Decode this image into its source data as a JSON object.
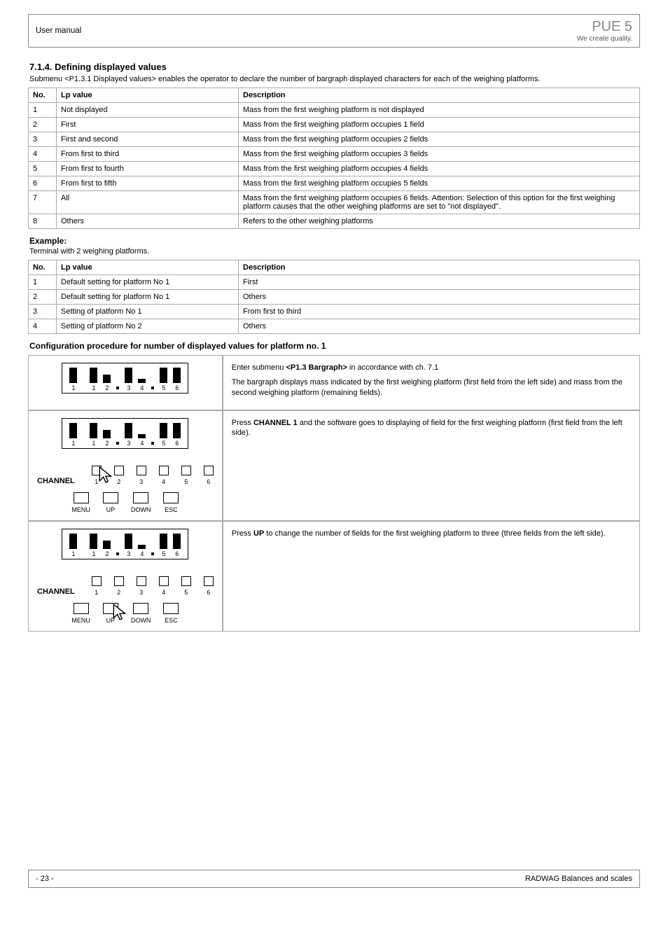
{
  "header": {
    "section": "User manual",
    "model": "PUE 5",
    "tagline": "We create quality."
  },
  "section_title": "7.1.4. Defining displayed values",
  "intro_text": "Submenu <P1.3.1 Displayed values> enables the operator to declare the number of bargraph displayed characters for each of the weighing platforms.",
  "table1": {
    "headers": [
      "No.",
      "Lp value",
      "Description"
    ],
    "rows": [
      [
        "1",
        "Not displayed",
        "Mass from the first weighing platform is not displayed"
      ],
      [
        "2",
        "First",
        "Mass from the first weighing platform occupies 1 field"
      ],
      [
        "3",
        "First and second",
        "Mass from the first weighing platform occupies 2 fields"
      ],
      [
        "4",
        "From first to third",
        "Mass from the first weighing platform occupies 3 fields"
      ],
      [
        "5",
        "From first to fourth",
        "Mass from the first weighing platform occupies 4 fields"
      ],
      [
        "6",
        "From first to fifth",
        "Mass from the first weighing platform occupies 5 fields"
      ],
      [
        "7",
        "All",
        "Mass from the first weighing platform occupies 6 fields. Attention: Selection of this option for the first weighing platform causes that the other weighing platforms are set to \"not displayed\"."
      ],
      [
        "8",
        "Others",
        "Refers to the other weighing platforms"
      ]
    ]
  },
  "example": {
    "title": "Example:",
    "text": "Terminal with 2 weighing platforms.",
    "table_headers": [
      "No.",
      "Lp value",
      "Description"
    ],
    "rows": [
      [
        "1",
        "Default setting for platform No 1",
        "First"
      ],
      [
        "2",
        "Default setting for platform No 1",
        "Others"
      ],
      [
        "3",
        "Setting of platform No 1",
        "From first to third"
      ],
      [
        "4",
        "Setting of platform No 2",
        "Others"
      ]
    ]
  },
  "config_title": "Configuration procedure for number of displayed values for platform no. 1",
  "config_rows": [
    {
      "left_label": "bargraph",
      "desc_lines": [
        "Enter submenu <P1.3 Bargraph> in accordance with ch. 7.1",
        "The bargraph displays mass indicated by the first weighing platform (first field from the left side) and mass from the second weighing platform (remaining fields)."
      ],
      "bars": [
        22,
        22,
        12,
        22,
        6,
        22,
        22
      ]
    },
    {
      "cursor_on": "CHANNEL_1",
      "desc_lines": [
        "Press CHANNEL 1 and the software goes to displaying of field for the first weighing platform (first field from the left side)."
      ],
      "bars": [
        22,
        22,
        12,
        22,
        6,
        22,
        22
      ]
    },
    {
      "cursor_on": "UP",
      "desc_lines": [
        "Press UP to change the number of fields for the first weighing platform to three (three fields from the left side)."
      ],
      "bars": [
        22,
        22,
        12,
        22,
        6,
        22,
        22
      ]
    }
  ],
  "labels": {
    "channel": "CHANNEL",
    "menu": "MENU",
    "up": "UP",
    "down": "DOWN",
    "esc": "ESC",
    "channel2_prefix": "CHANNEL 1",
    "up_btn": "UP"
  },
  "footer": {
    "page": "- 23 -",
    "company": "RADWAG Balances and scales"
  }
}
